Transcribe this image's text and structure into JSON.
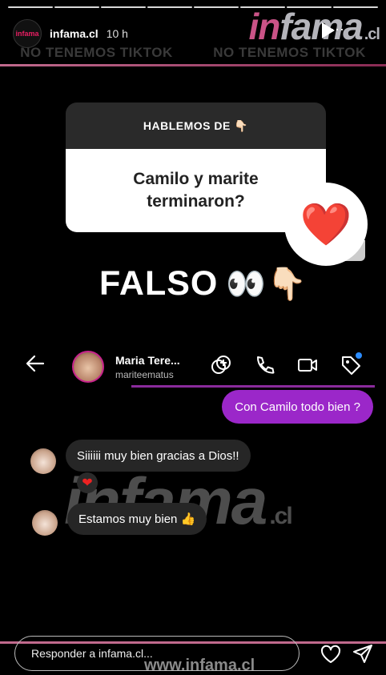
{
  "story": {
    "account": "infama.cl",
    "time": "10 h",
    "avatar_text": "infama"
  },
  "brand": {
    "prefix": "in",
    "name": "fama",
    "tld": ".cl"
  },
  "watermark_band": [
    "NO TENEMOS TIKTOK",
    "NO TENEMOS TIKTOK"
  ],
  "question_box": {
    "title": "HABLEMOS DE 👇🏻",
    "question": "Camilo y marite terminaron?"
  },
  "reaction_emoji": "❤️",
  "caption": {
    "text": "FALSO",
    "emoji": "👀👇🏻"
  },
  "chat": {
    "name": "Maria Tere...",
    "username": "mariteematus",
    "messages": [
      {
        "side": "out",
        "text": "Con Camilo todo bien ?"
      },
      {
        "side": "in",
        "text": "Siiiiii muy bien gracias a Dios!!"
      },
      {
        "side": "in",
        "text": "Estamos muy bien 👍"
      }
    ]
  },
  "overlay_watermark": {
    "name": "infama",
    "tld": ".cl"
  },
  "footer": {
    "reply_placeholder": "Responder a infama.cl...",
    "site": "www.infama.cl"
  },
  "colors": {
    "accent_purple": "#9b27c9",
    "stripe_pink": "#c06a8d",
    "heart_red": "#e22222"
  }
}
